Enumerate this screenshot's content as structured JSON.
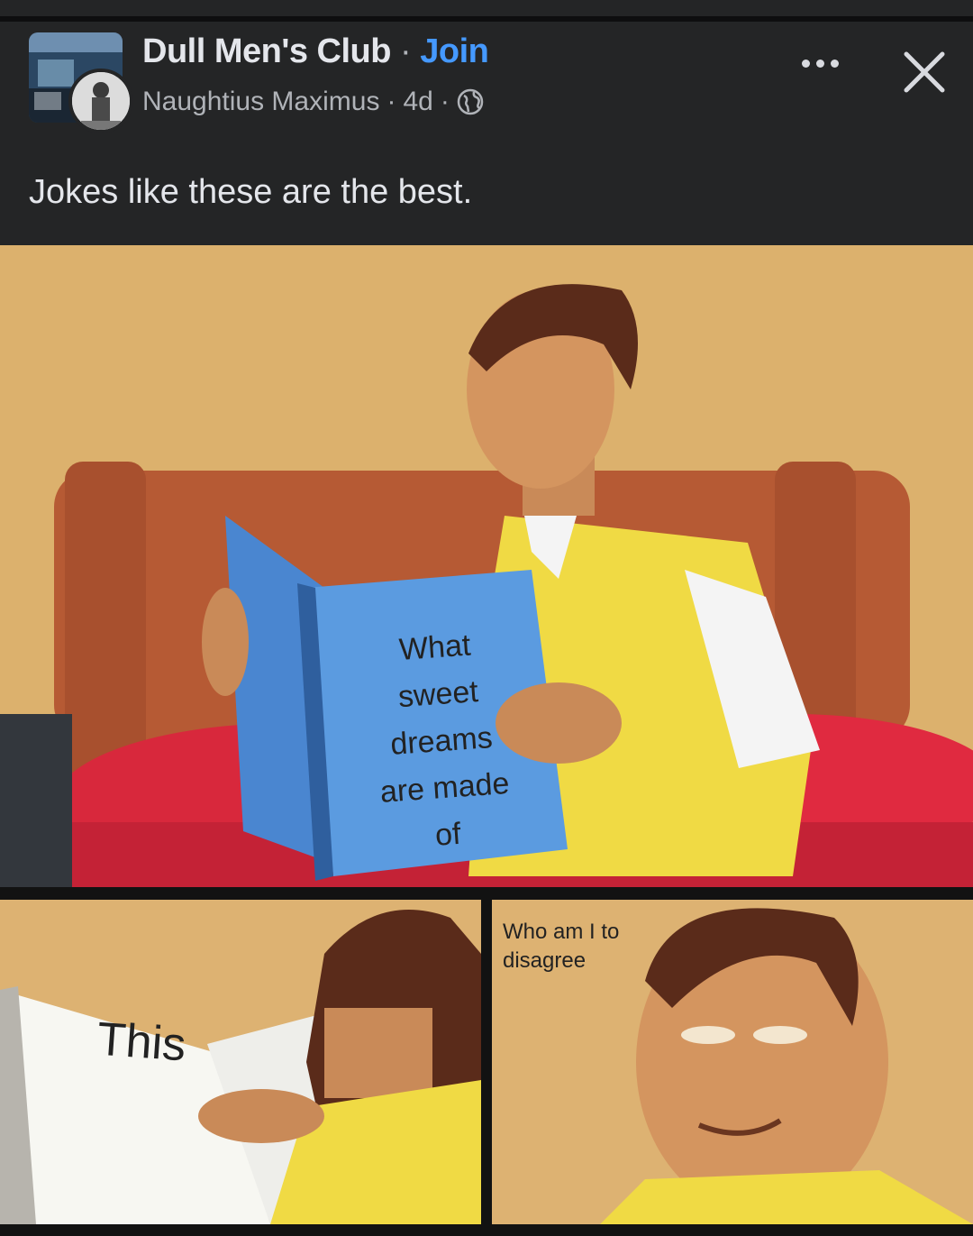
{
  "post": {
    "group_name": "Dull Men's Club",
    "separator": "·",
    "join_label": "Join",
    "author": "Naughtius Maximus",
    "time": "4d",
    "visibility_icon": "globe-icon",
    "more_icon": "more-options-icon",
    "close_icon": "close-icon",
    "caption": "Jokes like these are the best."
  },
  "meme": {
    "panel1": {
      "lines": [
        "What",
        "sweet",
        "dreams",
        "are made",
        "of"
      ]
    },
    "panel2": {
      "text": "This"
    },
    "panel3": {
      "lines": [
        "Who am I to",
        "disagree"
      ]
    }
  },
  "colors": {
    "background": "#242526",
    "text_primary": "#e4e6eb",
    "text_secondary": "#b0b3b8",
    "accent": "#4599ff"
  }
}
